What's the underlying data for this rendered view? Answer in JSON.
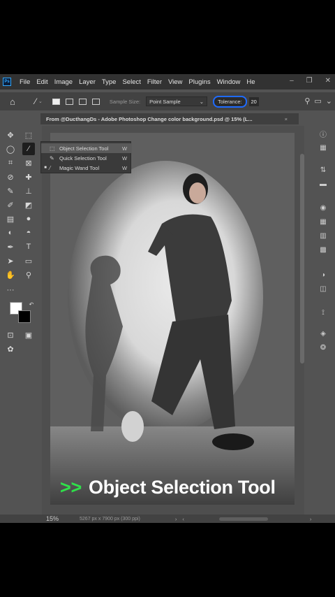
{
  "menubar": {
    "logo": "Ps",
    "items": [
      "File",
      "Edit",
      "Image",
      "Layer",
      "Type",
      "Select",
      "Filter",
      "View",
      "Plugins",
      "Window",
      "He"
    ],
    "window_controls": [
      "–",
      "❐",
      "✕"
    ]
  },
  "options": {
    "sample_size_label": "Sample Size:",
    "sample_size_value": "Point Sample",
    "tolerance_label": "Tolerance:",
    "tolerance_value": "20"
  },
  "document": {
    "tab_title": "From @DucthangDs - Adobe Photoshop Change color background.psd @ 15% (L...",
    "close": "×"
  },
  "flyout": {
    "items": [
      {
        "label": "Object Selection Tool",
        "key": "W",
        "icon": "object-selection-icon",
        "highlighted": true
      },
      {
        "label": "Quick Selection Tool",
        "key": "W",
        "icon": "quick-selection-icon",
        "highlighted": false
      },
      {
        "label": "Magic Wand Tool",
        "key": "W",
        "icon": "magic-wand-icon",
        "selected": true
      }
    ]
  },
  "caption": {
    "arrows": ">>",
    "text": "Object Selection Tool",
    "arrow_color": "#2fe04a"
  },
  "status": {
    "zoom": "15%",
    "dimensions": "5267 px x 7900 px (300 ppi)",
    "left_arrow": "‹",
    "right_arrow": "›",
    "expand": "›"
  },
  "colors": {
    "accent": "#1f6bff",
    "foreground": "#ffffff",
    "background": "#000000"
  }
}
